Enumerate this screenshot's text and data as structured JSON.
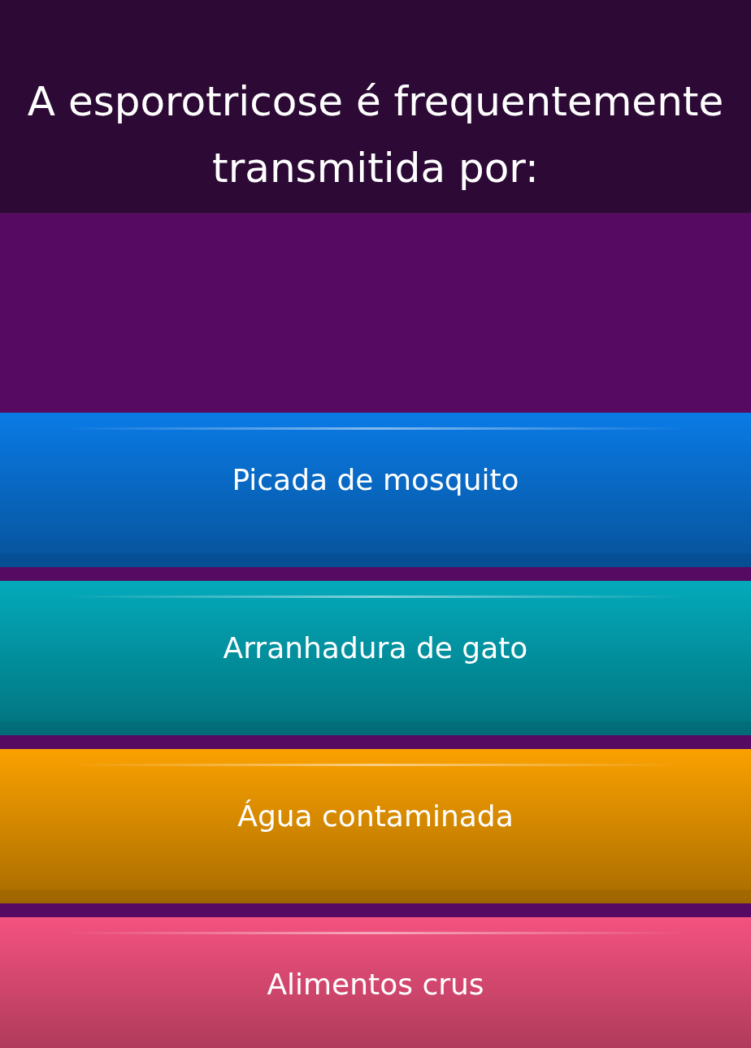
{
  "question": {
    "text": "A esporotricose é frequentemente transmitida por:"
  },
  "answers": [
    {
      "label": "Picada de mosquito",
      "color": "#0a7be6"
    },
    {
      "label": "Arranhadura de gato",
      "color": "#03aabb"
    },
    {
      "label": "Água contaminada",
      "color": "#fba100"
    },
    {
      "label": "Alimentos crus",
      "color": "#f4527f"
    }
  ]
}
